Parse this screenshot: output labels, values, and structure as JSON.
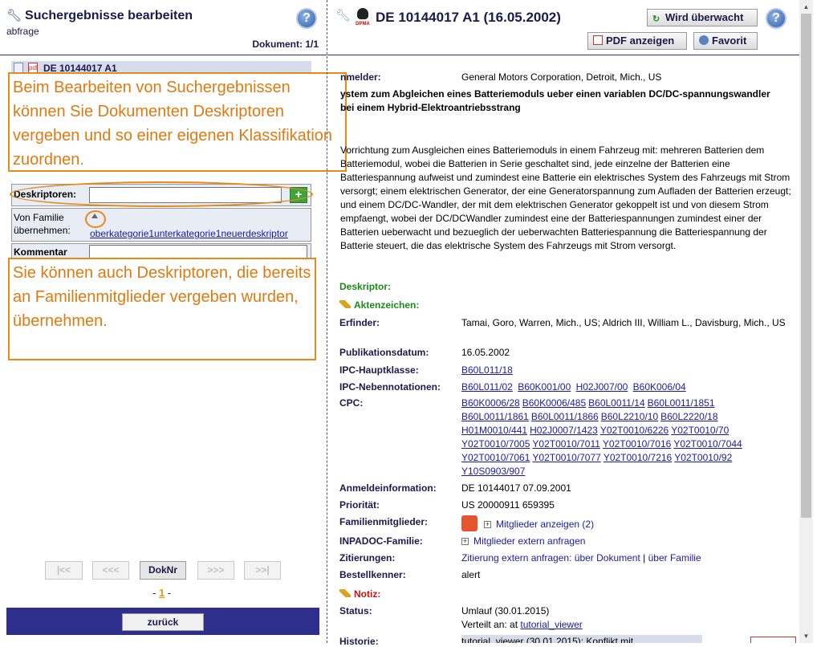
{
  "left": {
    "title": "Suchergebnisse bearbeiten",
    "subtitle": "abfrage",
    "help": "?",
    "doc_count": "Dokument: 1/1",
    "doc_row": "DE 10144017 A1",
    "callout1": "Beim Bearbeiten von Suchergebnissen können Sie Dokumenten Deskriptoren vergeben und so einer eigenen Klassifikation zuordnen.",
    "callout2": "Sie können auch Deskriptoren, die bereits an Familienmitglieder vergeben wurden, übernehmen.",
    "deskriptoren_label": "Deskriptoren:",
    "deskriptoren_value": "",
    "add": "+",
    "von_familie_label": "Von Familie übernehmen:",
    "von_familie_link": "oberkategorie1unterkategorie1neuerdeskriptor",
    "kommentar_label": "Kommentar",
    "pager": [
      "|<<",
      "<<<",
      "DokNr",
      ">>>",
      ">>|"
    ],
    "page_prefix": "- ",
    "page": "1",
    "page_suffix": " -",
    "back": "zurück"
  },
  "right": {
    "title": "DE 10144017 A1 (16.05.2002)",
    "eagle_label": "DPMA",
    "watch_button": "Wird überwacht",
    "pdf_button": "PDF anzeigen",
    "fav_button": "Favorit",
    "help": "?",
    "anmelder_label": "nmelder:",
    "anmelder_value": "General Motors Corporation, Detroit, Mich., US",
    "heading": "ystem zum Abgleichen eines Batteriemoduls ueber einen variablen DC/DC-spannungswandler bei einem Hybrid-Elektroantriebsstrang",
    "abstract": "Vorrichtung zum Ausgleichen eines Batteriemoduls in einem Fahrzeug mit: mehreren Batterien dem Batteriemodul, wobei die Batterien in Serie geschaltet sind, jede einzelne der Batterien eine Batteriespannung aufweist und zumindest eine Batterie ein elektrisches System des Fahrzeugs mit Strom versorgt; einem elektrischen Generator, der eine Generatorspannung zum Aufladen der Batterien erzeugt; und einem DC/DC-Wandler, der mit dem elektrischen Generator gekoppelt ist und von diesem Strom empfaengt, wobei der DC/DCWandler zumindest eine der Batteriespannungen zumindest einer der Batterien ueberwacht und bezueglich der ueberwachten Batteriespannung die Batteriespannung der Batterie steuert, die das elektrische System des Fahrzeugs mit Strom versorgt.",
    "deskriptor_label": "Deskriptor:",
    "aktenzeichen_label": "Aktenzeichen:",
    "erfinder_label": "Erfinder:",
    "erfinder_value": "Tamai, Goro, Warren, Mich., US; Aldrich III, William L., Davisburg, Mich., US",
    "pubdate_label": "Publikationsdatum:",
    "pubdate_value": "16.05.2002",
    "ipc_haupt_label": "IPC-Hauptklasse:",
    "ipc_haupt_value": "B60L011/18",
    "ipc_neben_label": "IPC-Nebennotationen:",
    "ipc_neben_values": [
      "B60L011/02",
      "B60K001/00",
      "H02J007/00",
      "B60K006/04"
    ],
    "cpc_label": "CPC:",
    "cpc_rows": [
      [
        "B60K0006/28",
        "B60K0006/485",
        "B60L0011/14",
        "B60L0011/1851"
      ],
      [
        "B60L0011/1861",
        "B60L0011/1866",
        "B60L2210/10",
        "B60L2220/18"
      ],
      [
        "H01M0010/441",
        "H02J0007/1423",
        "Y02T0010/6226",
        "Y02T0010/70"
      ],
      [
        "Y02T0010/7005",
        "Y02T0010/7011",
        "Y02T0010/7016",
        "Y02T0010/7044"
      ],
      [
        "Y02T0010/7061",
        "Y02T0010/7077",
        "Y02T0010/7216",
        "Y02T0010/92"
      ],
      [
        "Y10S0903/907"
      ]
    ],
    "anmeldeinfo_label": "Anmeldeinformation:",
    "anmeldeinfo_value": "DE 10144017 07.09.2001",
    "prioritaet_label": "Priorität:",
    "prioritaet_value": "US 20000911 659395",
    "familien_label": "Familienmitglieder:",
    "familien_value": "Mitglieder anzeigen (2)",
    "inpadoc_label": "INPADOC-Familie:",
    "inpadoc_value": "Mitglieder extern anfragen",
    "zitierungen_label": "Zitierungen:",
    "zitierungen_prefix": "Zitierung extern anfragen:",
    "zitierungen_link1": "über Dokument",
    "zitierungen_sep": "|",
    "zitierungen_link2": "über Familie",
    "bestell_label": "Bestellkenner:",
    "bestell_value": "alert",
    "notiz_label": "Notiz:",
    "status_label": "Status:",
    "status_value": "Umlauf (30.01.2015)",
    "verteilt_prefix": "Verteilt an: at",
    "verteilt_link": "tutorial_viewer",
    "historie_label": "Historie:",
    "historie_value": "tutorial_viewer (30.01.2015): Konflikt mit..."
  },
  "colors": {
    "navy": "#1a1a4d",
    "orange": "#e88a1a",
    "green": "#1a8a1a",
    "red": "#d01010",
    "bar": "#2e2e8c"
  }
}
